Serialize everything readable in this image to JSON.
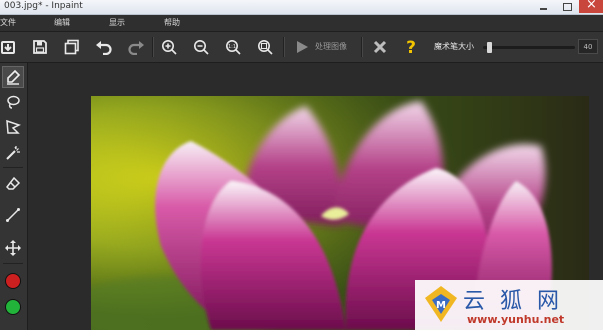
{
  "window": {
    "title": "003.jpg* - Inpaint"
  },
  "menu": {
    "items": [
      "文件",
      "编辑",
      "显示",
      "帮助"
    ]
  },
  "toolbar": {
    "process_label": "处理图像",
    "brush_size_label": "魔术笔大小",
    "brush_size_value": "40",
    "brush_size_fraction": 0.05
  },
  "colors": {
    "foreground_color": "#cc1f1f",
    "background_color": "#22b33a",
    "help_icon": "#f2c500"
  },
  "icons": {
    "toolbar": [
      "open-icon",
      "save-icon",
      "save-as-icon",
      "undo-icon",
      "redo-icon",
      "zoom-in-icon",
      "zoom-out-icon",
      "zoom-actual-icon",
      "zoom-fit-icon",
      "play-icon",
      "close-icon",
      "help-icon"
    ],
    "sidebar": [
      "marker-icon",
      "lasso-icon",
      "polygon-lasso-icon",
      "magic-wand-icon",
      "eraser-icon",
      "line-icon",
      "move-icon"
    ]
  },
  "watermark": {
    "text": "云 狐 网",
    "url": "www.yunhu.net"
  }
}
